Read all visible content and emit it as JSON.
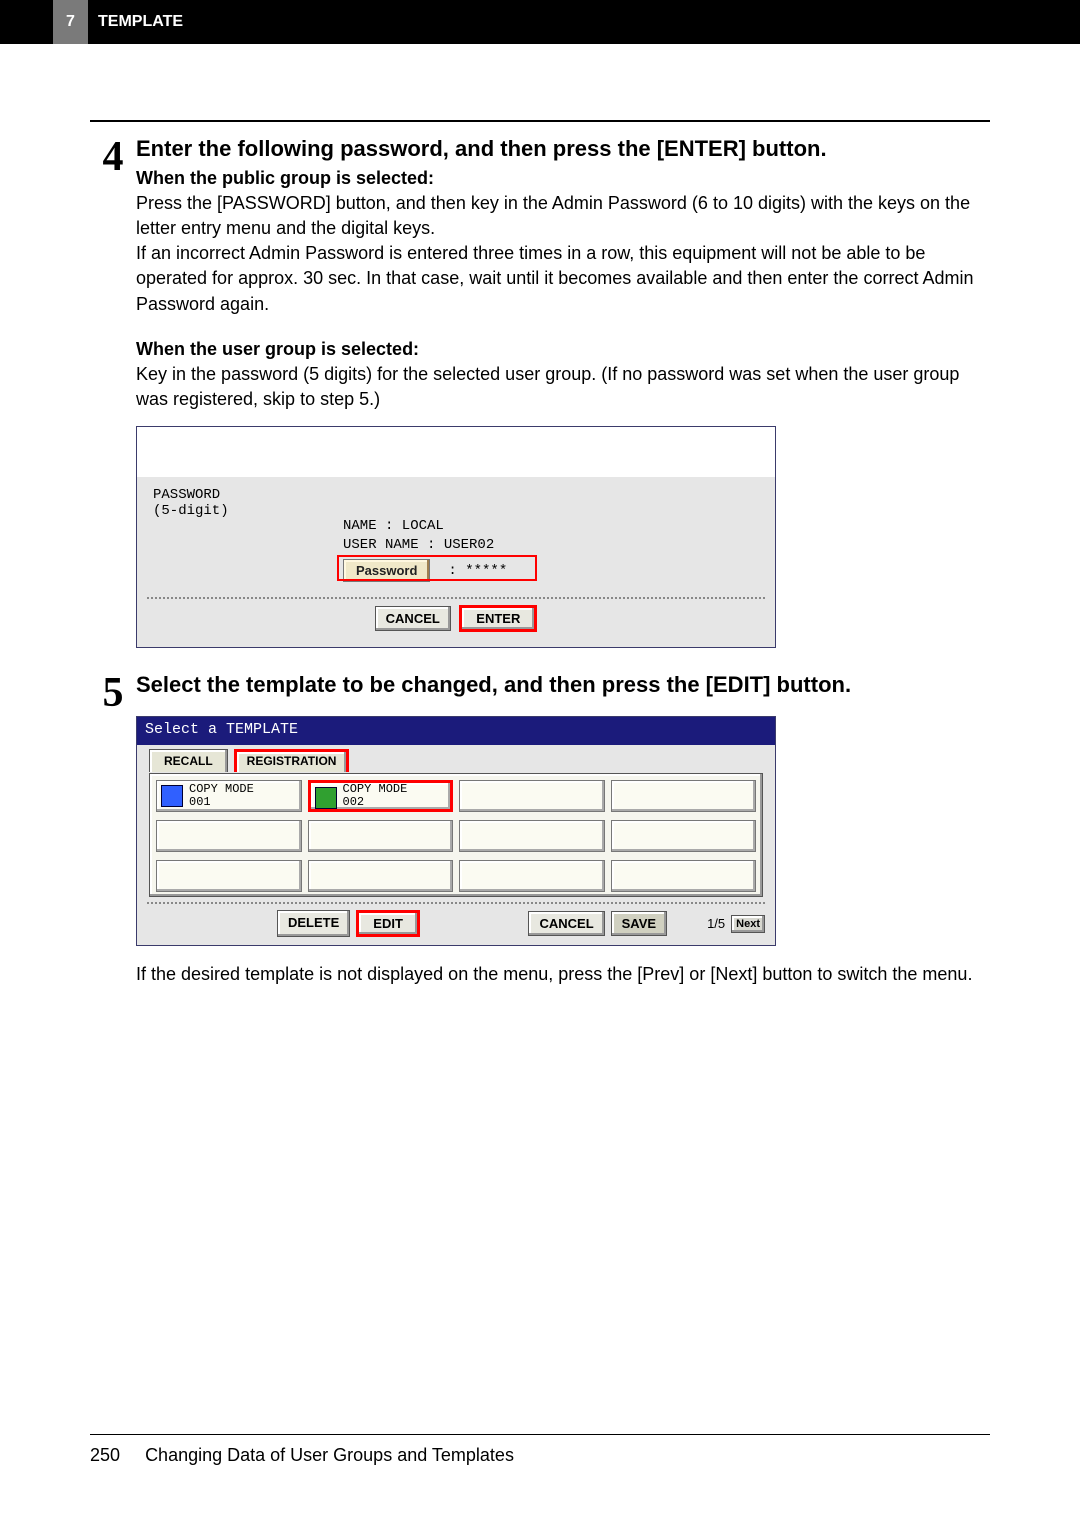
{
  "header": {
    "chapter_number": "7",
    "chapter_title": "TEMPLATE"
  },
  "step4": {
    "number": "4",
    "heading": "Enter the following password, and then press the [ENTER] button.",
    "sub1": "When the public group is selected:",
    "text1": "Press the [PASSWORD] button, and then key in the Admin Password (6 to 10 digits) with the keys on the letter entry menu and the digital keys.",
    "text2": "If an incorrect Admin Password is entered three times in a row, this equipment will not be able to be operated for approx. 30 sec. In that case, wait until it becomes available and then enter the correct Admin Password again.",
    "sub2": "When the user group is selected:",
    "text3": "Key in the password (5 digits) for the selected user group. (If no password was set when the user group was registered, skip to step 5.)"
  },
  "shot1": {
    "pwd_label_line1": "PASSWORD",
    "pwd_label_line2": "(5-digit)",
    "name_line": "NAME      : LOCAL",
    "user_line": "USER NAME : USER02",
    "password_btn": "Password",
    "password_mask": ": *****",
    "cancel": "CANCEL",
    "enter": "ENTER"
  },
  "step5": {
    "number": "5",
    "heading": "Select the template to be changed, and then press the [EDIT] button."
  },
  "shot2": {
    "title": "Select a TEMPLATE",
    "tab_recall": "RECALL",
    "tab_registration": "REGISTRATION",
    "tmpl1_line1": "COPY MODE",
    "tmpl1_line2": "001",
    "tmpl2_line1": "COPY MODE",
    "tmpl2_line2": "002",
    "delete": "DELETE",
    "edit": "EDIT",
    "cancel": "CANCEL",
    "save": "SAVE",
    "page_indicator": "1/5",
    "next": "Next"
  },
  "note5": "If the desired template is not displayed on the menu, press the [Prev] or [Next] button to switch the menu.",
  "footer": {
    "page_number": "250",
    "section": "Changing Data of User Groups and Templates"
  }
}
